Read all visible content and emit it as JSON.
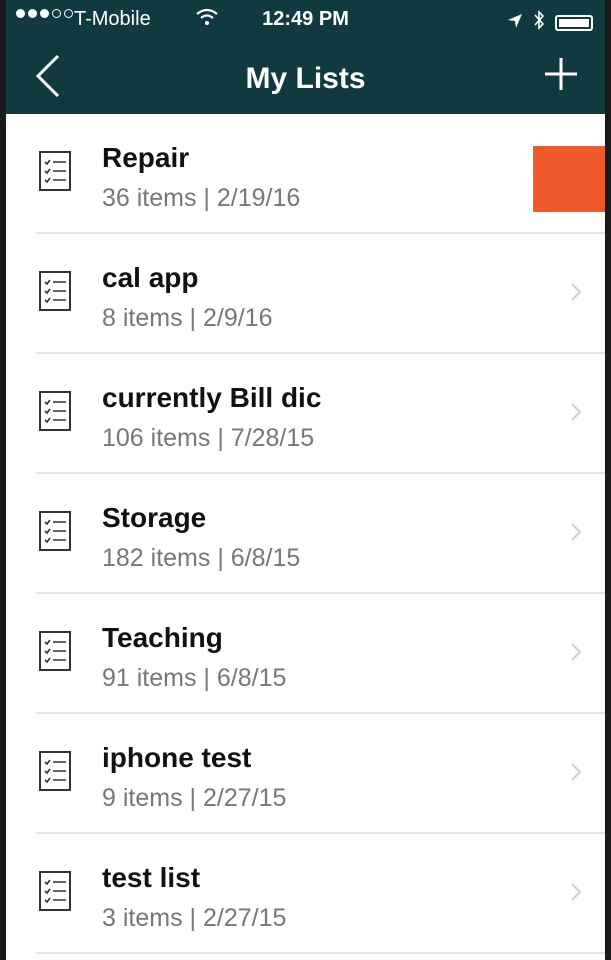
{
  "status_bar": {
    "carrier": "T-Mobile",
    "time": "12:49 PM",
    "signal_dots": [
      true,
      true,
      true,
      false,
      false
    ]
  },
  "nav": {
    "title": "My Lists",
    "back_icon": "chevron-left-icon",
    "add_icon": "plus-icon"
  },
  "colors": {
    "header_bg": "#103a40",
    "delete_accent": "#ee5a2c"
  },
  "lists": [
    {
      "title": "Repair",
      "meta": "36 items  |  2/19/16",
      "swiped": true
    },
    {
      "title": "cal app",
      "meta": "8 items  |  2/9/16",
      "swiped": false
    },
    {
      "title": "currently Bill dic",
      "meta": "106 items  |  7/28/15",
      "swiped": false
    },
    {
      "title": "Storage",
      "meta": "182 items  |  6/8/15",
      "swiped": false
    },
    {
      "title": "Teaching",
      "meta": "91 items  |  6/8/15",
      "swiped": false
    },
    {
      "title": "iphone test",
      "meta": "9 items  |  2/27/15",
      "swiped": false
    },
    {
      "title": "test list",
      "meta": "3 items  |  2/27/15",
      "swiped": false
    }
  ]
}
